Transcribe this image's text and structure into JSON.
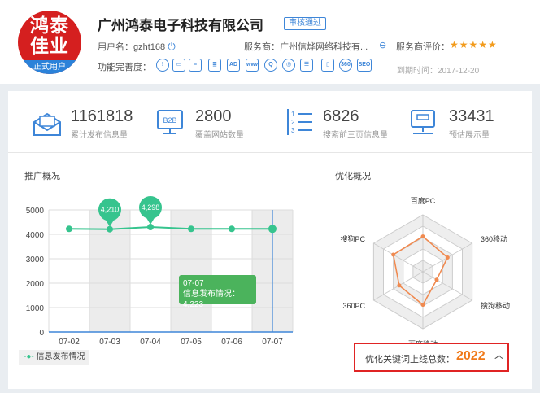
{
  "header": {
    "logo_text_line1": "鸿泰",
    "logo_text_line2": "佳业",
    "logo_badge": "正式用户",
    "company_name": "广州鸿泰电子科技有限公司",
    "verified_badge": "审核通过",
    "username_label": "用户名：gzht168",
    "provider_label": "服务商：广州信烨网络科技有...",
    "rating_label": "服务商评价：",
    "stars": "★★★★★",
    "features_label": "功能完善度：",
    "feature_icons": [
      "AD",
      "www",
      "360",
      "SEO"
    ],
    "expire": "到期时间：2017-12-20"
  },
  "stats": [
    {
      "value": "1161818",
      "label": "累计发布信息量",
      "icon": "envelope-icon"
    },
    {
      "value": "2800",
      "label": "覆盖网站数量",
      "icon": "b2b-monitor-icon",
      "icon_text": "B2B"
    },
    {
      "value": "6826",
      "label": "搜索前三页信息量",
      "icon": "list-icon",
      "icon_text": [
        "1",
        "2",
        "3"
      ]
    },
    {
      "value": "33431",
      "label": "预估展示量",
      "icon": "display-icon"
    }
  ],
  "promo": {
    "title": "推广概况",
    "legend": "信息发布情况",
    "tooltip_date": "07-07",
    "tooltip_text": "信息发布情况：4,223"
  },
  "optimize": {
    "title": "优化概况",
    "label": "优化关键词上线总数：",
    "value": "2022",
    "unit": "个"
  },
  "chart_data": [
    {
      "type": "line",
      "x": [
        "07-02",
        "07-03",
        "07-04",
        "07-05",
        "07-06",
        "07-07"
      ],
      "series": [
        {
          "name": "信息发布情况",
          "values": [
            4223,
            4210,
            4298,
            4223,
            4223,
            4223
          ]
        }
      ],
      "ylim": [
        0,
        5000
      ],
      "yticks": [
        0,
        1000,
        2000,
        3000,
        4000,
        5000
      ],
      "data_labels": [
        {
          "x": "07-03",
          "label": "4,210"
        },
        {
          "x": "07-04",
          "label": "4,298"
        }
      ],
      "color": "#36c48e"
    },
    {
      "type": "radar",
      "axes": [
        "百度PC",
        "360移动",
        "搜狗移动",
        "百度移动",
        "360PC",
        "搜狗PC"
      ],
      "values": [
        0.62,
        0.5,
        0.28,
        0.58,
        0.48,
        0.6
      ],
      "color": "#f08a50"
    }
  ]
}
